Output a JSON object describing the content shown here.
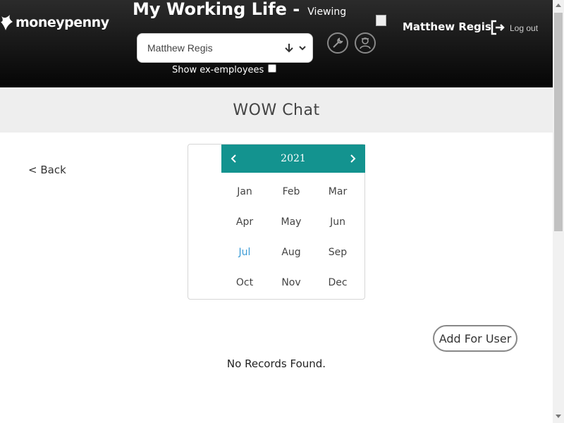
{
  "header": {
    "logo_text": "moneypenny",
    "title": "My Working Life -",
    "title_suffix": "Viewing",
    "employee_select_value": "Matthew Regis",
    "show_ex_employees_label": "Show ex-employees",
    "show_ex_employees_checked": false,
    "user_name": "Matthew Regis",
    "logout_label": "Log out"
  },
  "page": {
    "title": "WOW Chat",
    "back_label": "< Back",
    "add_button_label": "Add For User",
    "empty_message": "No Records Found."
  },
  "month_picker": {
    "year": "2021",
    "prev_icon": "chevron-left-icon",
    "next_icon": "chevron-right-icon",
    "months": [
      "Jan",
      "Feb",
      "Mar",
      "Apr",
      "May",
      "Jun",
      "Jul",
      "Aug",
      "Sep",
      "Oct",
      "Nov",
      "Dec"
    ],
    "current_month": "Jul"
  },
  "colors": {
    "accent_teal": "#13938f",
    "current_month_blue": "#3b9bd6",
    "header_dark": "#111111"
  }
}
